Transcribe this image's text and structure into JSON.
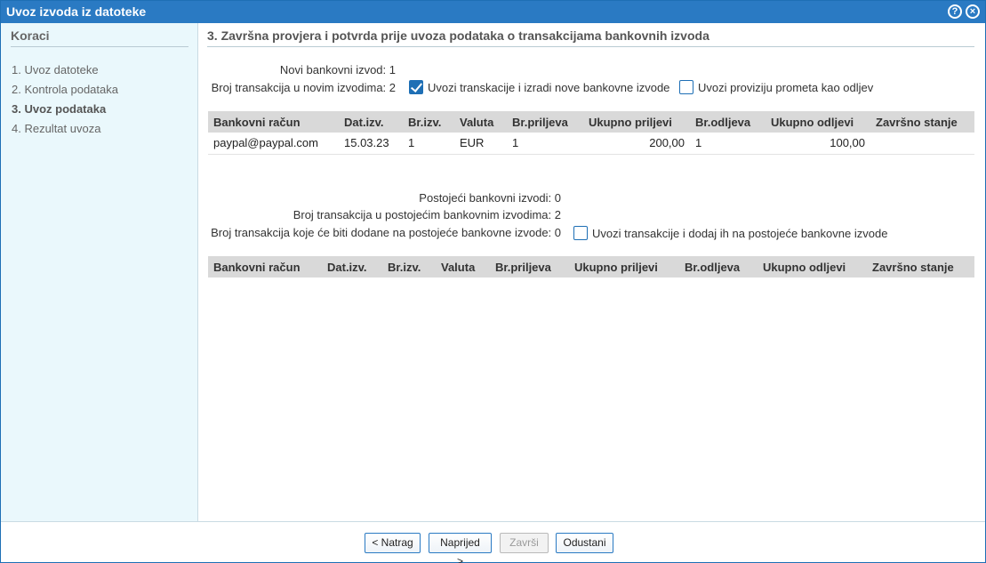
{
  "window": {
    "title": "Uvoz izvoda iz datoteke",
    "help_icon": "question-circle-icon",
    "close_icon": "close-circle-icon"
  },
  "sidebar": {
    "heading": "Koraci",
    "steps": [
      {
        "label": "1. Uvoz datoteke",
        "active": false
      },
      {
        "label": "2. Kontrola podataka",
        "active": false
      },
      {
        "label": "3. Uvoz podataka",
        "active": true
      },
      {
        "label": "4. Rezultat uvoza",
        "active": false
      }
    ]
  },
  "main": {
    "heading": "3. Završna provjera i potvrda prije uvoza podataka o transakcijama bankovnih izvoda",
    "new_section": {
      "new_statements": "Novi bankovni izvod: 1",
      "transactions_new": "Broj transakcija u novim izvodima: 2",
      "cb_import_new": {
        "label": "Uvozi transkacije i izradi nove bankovne izvode",
        "checked": true
      },
      "cb_commission": {
        "label": "Uvozi proviziju prometa kao odljev",
        "checked": false
      },
      "columns": [
        "Bankovni račun",
        "Dat.izv.",
        "Br.izv.",
        "Valuta",
        "Br.priljeva",
        "Ukupno priljevi",
        "Br.odljeva",
        "Ukupno odljevi",
        "Završno stanje"
      ],
      "rows": [
        [
          "paypal@paypal.com",
          "15.03.23",
          "1",
          "EUR",
          "1",
          "200,00",
          "1",
          "100,00",
          ""
        ]
      ]
    },
    "existing_section": {
      "existing_statements": "Postojeći bankovni izvodi: 0",
      "transactions_existing": "Broj transakcija u postojećim bankovnim izvodima: 2",
      "transactions_added": "Broj transakcija koje će biti dodane na postojeće bankovne izvode: 0",
      "cb_import_existing": {
        "label": "Uvozi transakcije i dodaj ih na postojeće bankovne izvode",
        "checked": false
      },
      "columns": [
        "Bankovni račun",
        "Dat.izv.",
        "Br.izv.",
        "Valuta",
        "Br.priljeva",
        "Ukupno priljevi",
        "Br.odljeva",
        "Ukupno odljevi",
        "Završno stanje"
      ]
    }
  },
  "footer": {
    "back": "< Natrag",
    "next": "Naprijed >",
    "finish": "Završi",
    "cancel": "Odustani"
  },
  "colors": {
    "titlebar": "#2a7ac3",
    "sidebar_bg": "#eaf8fc",
    "table_header_bg": "#d9d9d9",
    "accent": "#1e6fb5"
  }
}
